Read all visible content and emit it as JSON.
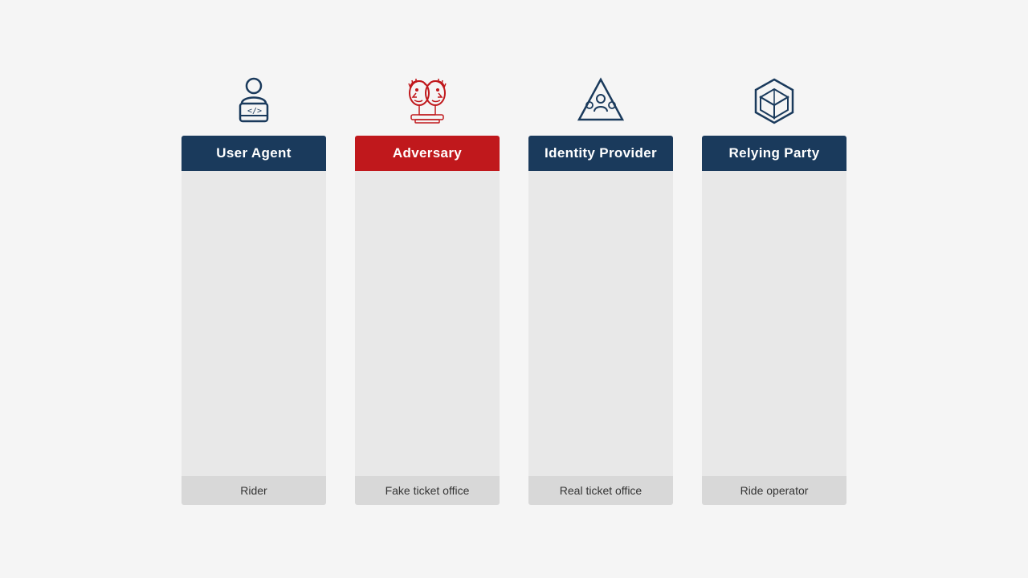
{
  "actors": [
    {
      "id": "user-agent",
      "header": "User Agent",
      "header_class": "header-navy",
      "footer": "Rider",
      "icon_type": "coder"
    },
    {
      "id": "adversary",
      "header": "Adversary",
      "header_class": "header-red",
      "footer": "Fake ticket office",
      "icon_type": "adversary"
    },
    {
      "id": "identity-provider",
      "header": "Identity Provider",
      "header_class": "header-navy",
      "footer": "Real ticket office",
      "icon_type": "group"
    },
    {
      "id": "relying-party",
      "header": "Relying Party",
      "header_class": "header-navy",
      "footer": "Ride operator",
      "icon_type": "box"
    }
  ]
}
